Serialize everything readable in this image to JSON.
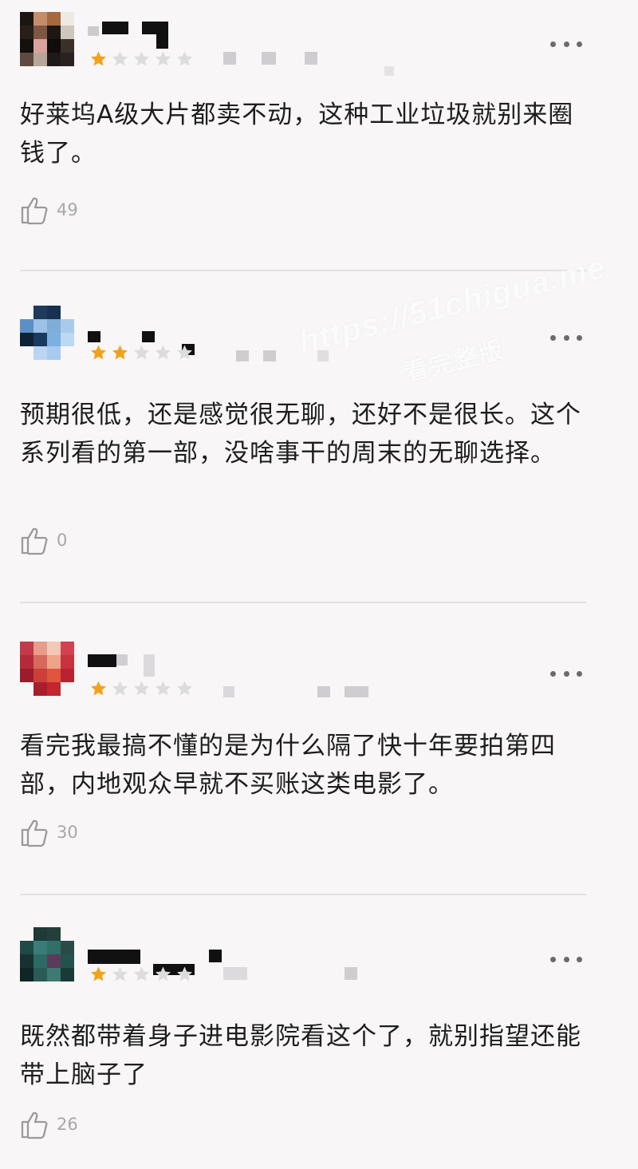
{
  "reviews": [
    {
      "rating": 1,
      "text": "好莱坞A级大片都卖不动，这种工业垃圾就别来圈钱了。",
      "likes": "49"
    },
    {
      "rating": 2,
      "text": "预期很低，还是感觉很无聊，还好不是很长。这个系列看的第一部，没啥事干的周末的无聊选择。",
      "likes": "0"
    },
    {
      "rating": 1,
      "text": "看完我最搞不懂的是为什么隔了快十年要拍第四部，内地观众早就不买账这类电影了。",
      "likes": "30"
    },
    {
      "rating": 1,
      "text": "既然都带着身子进电影院看这个了，就别指望还能带上脑子了",
      "likes": "26"
    }
  ],
  "watermark": {
    "url": "https://51chigua.me",
    "label": "看完整版"
  },
  "colors": {
    "star_filled": "#f0a21a",
    "star_empty": "#dcdcdc",
    "background": "#f8f6f7"
  }
}
